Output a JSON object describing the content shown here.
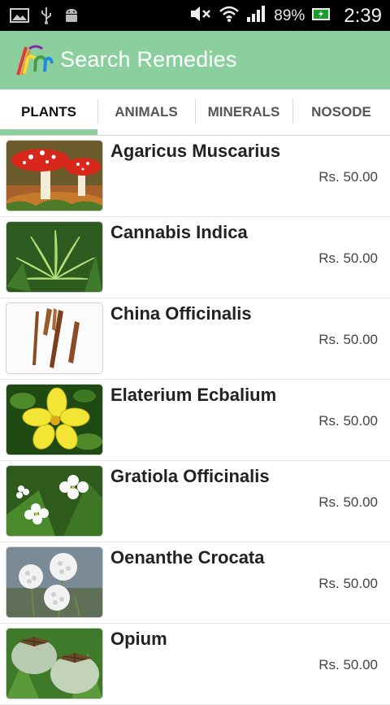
{
  "status_bar": {
    "battery_percent": "89%",
    "time": "2:39"
  },
  "action_bar": {
    "title": "Search Remedies"
  },
  "tabs": [
    {
      "label": "PLANTS",
      "active": true
    },
    {
      "label": "ANIMALS",
      "active": false
    },
    {
      "label": "MINERALS",
      "active": false
    },
    {
      "label": "NOSODE",
      "active": false
    }
  ],
  "remedies": [
    {
      "name": "Agaricus Muscarius",
      "price": "Rs. 50.00",
      "image": "mushroom-image"
    },
    {
      "name": "Cannabis Indica",
      "price": "Rs. 50.00",
      "image": "cannabis-leaf-image"
    },
    {
      "name": "China Officinalis",
      "price": "Rs. 50.00",
      "image": "bark-sticks-image"
    },
    {
      "name": "Elaterium Ecbalium",
      "price": "Rs. 50.00",
      "image": "yellow-flower-image"
    },
    {
      "name": "Gratiola Officinalis",
      "price": "Rs. 50.00",
      "image": "white-flowers-image"
    },
    {
      "name": "Oenanthe Crocata",
      "price": "Rs. 50.00",
      "image": "umbel-flower-image"
    },
    {
      "name": "Opium",
      "price": "Rs. 50.00",
      "image": "poppy-pods-image"
    }
  ],
  "colors": {
    "accent": "#8ccf9f",
    "status_bar": "#000000"
  }
}
